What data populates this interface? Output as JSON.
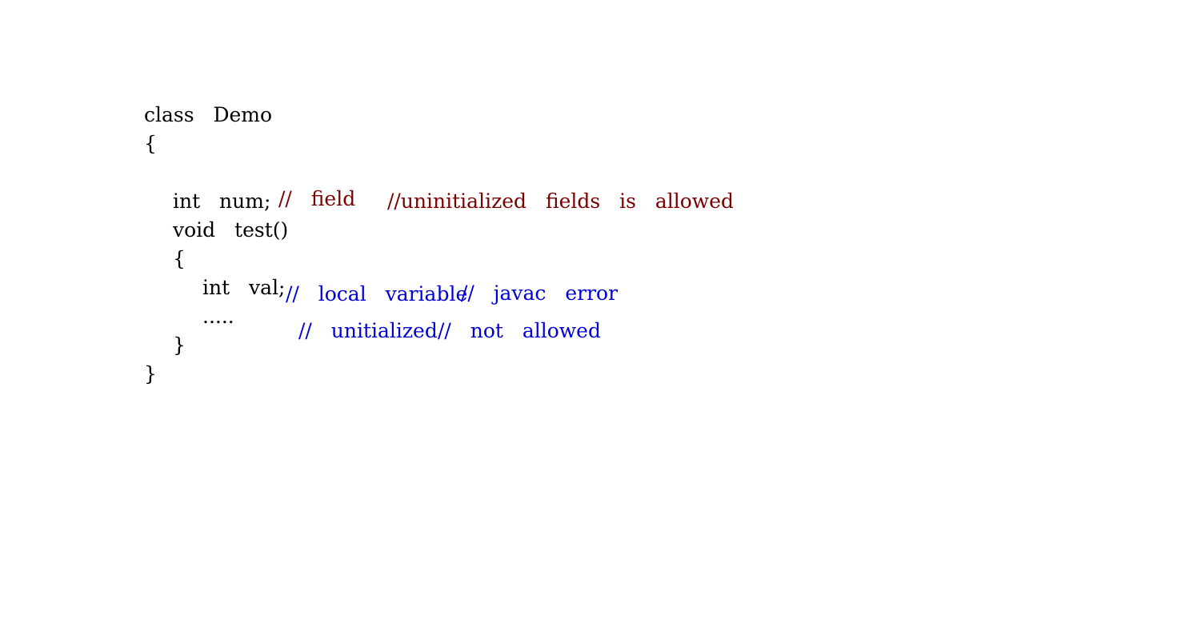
{
  "code": {
    "line_class": "class  Demo",
    "line_open_brace_1": "{",
    "line_field": "int  num;",
    "line_method": "void  test()",
    "line_open_brace_2": "{",
    "line_local": "int  val;",
    "line_ellipsis": ".....",
    "line_close_brace_2": "}",
    "line_close_brace_1": "}"
  },
  "comments": {
    "field_label": "//  field",
    "field_note": "//uninitialized  fields  is  allowed",
    "local_label": "//  local  variable",
    "local_error": "//  javac  error",
    "uninit_label": "//  unitialized",
    "not_allowed": "//  not  allowed"
  },
  "colors": {
    "code_text": "#000000",
    "field_comment": "#7a0000",
    "local_comment": "#0000d8",
    "background": "#ffffff"
  }
}
